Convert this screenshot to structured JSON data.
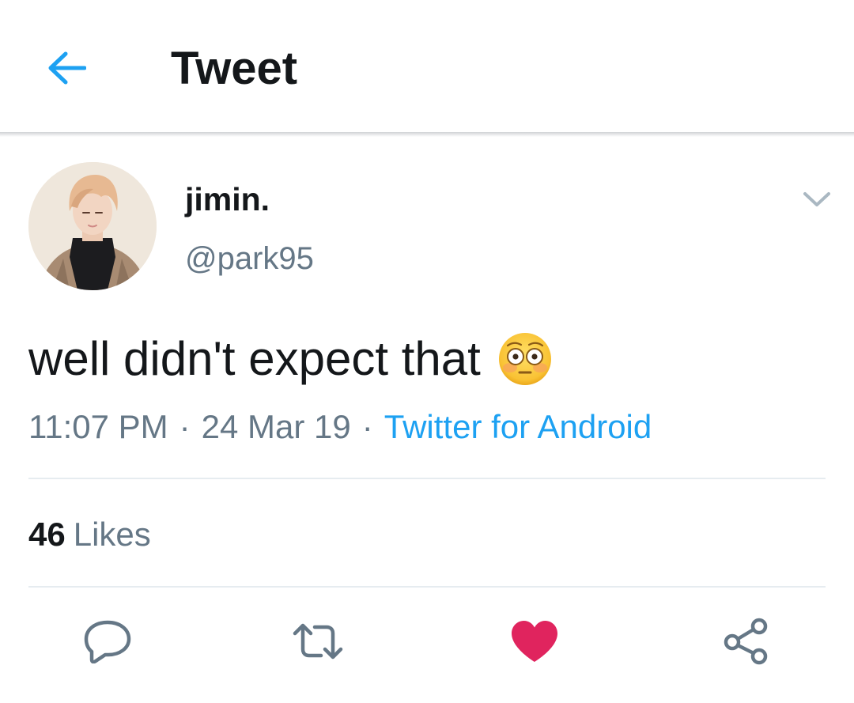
{
  "header": {
    "title": "Tweet",
    "back_icon": "arrow-left-icon"
  },
  "author": {
    "display_name": "jimin.",
    "handle": "@park95",
    "menu_icon": "chevron-down-icon"
  },
  "tweet": {
    "text": "well didn't expect that",
    "emoji": "flushed-face-emoji",
    "time": "11:07 PM",
    "date": "24 Mar 19",
    "separator": "·",
    "source": "Twitter for Android"
  },
  "stats": {
    "likes_count": "46",
    "likes_label": "Likes"
  },
  "actions": {
    "reply_icon": "reply-icon",
    "retweet_icon": "retweet-icon",
    "like_icon": "heart-icon",
    "share_icon": "share-icon",
    "liked": true
  },
  "colors": {
    "accent": "#1da1f2",
    "like": "#e0245e",
    "secondary_text": "#657786",
    "primary_text": "#14171a",
    "divider": "#e6ecf0"
  }
}
